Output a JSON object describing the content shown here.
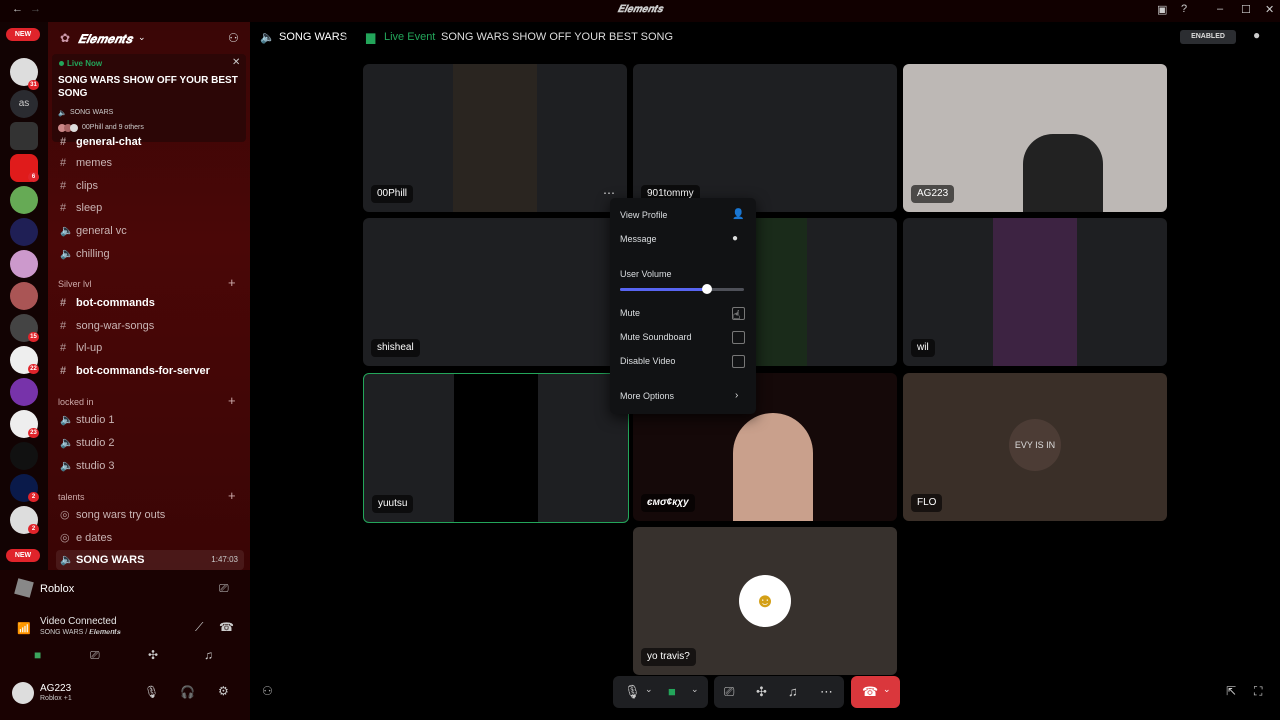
{
  "window": {
    "title": "𝑬𝒍𝒆𝒎𝒆𝒏𝒕𝒔"
  },
  "guilds": {
    "badges": [
      "9",
      "31",
      "6",
      "15",
      "22",
      "23",
      "2",
      "2"
    ],
    "new_top": "NEW",
    "new_bottom": "NEW",
    "as_label": "as"
  },
  "server": {
    "name": "𝑬𝒍𝒆𝒎𝒆𝒏𝒕𝒔",
    "live_now": "Live Now",
    "event_title": "SONG WARS SHOW OFF YOUR BEST SONG",
    "event_channel": "SONG WARS",
    "event_attendees": "00Phill and 9 others"
  },
  "channels": {
    "top": [
      "general-chat",
      "memes",
      "clips",
      "sleep",
      "general vc",
      "chilling"
    ],
    "silver_label": "Silver lvl",
    "silver": [
      "bot-commands",
      "song-war-songs",
      "lvl-up",
      "bot-commands-for-server"
    ],
    "locked_label": "locked in",
    "locked": [
      "studio 1",
      "studio 2",
      "studio 3"
    ],
    "talents_label": "talents",
    "talents": [
      "song wars try outs",
      "e dates",
      "SONG WARS"
    ],
    "song_wars_timer": "1:47:03"
  },
  "activity": {
    "game": "Roblox"
  },
  "voice": {
    "status": "Video Connected",
    "channel": "SONG WARS / 𝑬𝒍𝒆𝒎𝒆𝒏𝒕𝒔"
  },
  "user": {
    "name": "AG223",
    "status": "Roblox +1"
  },
  "header": {
    "channel": "SONG WARS",
    "live_event": "Live Event",
    "event_name": "SONG WARS SHOW OFF YOUR BEST SONG",
    "enabled": "ENABLED"
  },
  "tiles": [
    "00Phill",
    "901tommy",
    "AG223",
    "shisheal",
    "wil",
    "yuutsu",
    "ємσ¢кχу",
    "FLO",
    "yo travis?"
  ],
  "flo_art_text": "EVY IS IN",
  "context_menu": {
    "view_profile": "View Profile",
    "message": "Message",
    "user_volume": "User Volume",
    "volume_level": 0.7,
    "mute": "Mute",
    "mute_soundboard": "Mute Soundboard",
    "disable_video": "Disable Video",
    "more_options": "More Options"
  },
  "colors": {
    "accent": "#5865f2",
    "danger": "#da373c",
    "live": "#23a55a",
    "sidebar": "#3f0606"
  }
}
